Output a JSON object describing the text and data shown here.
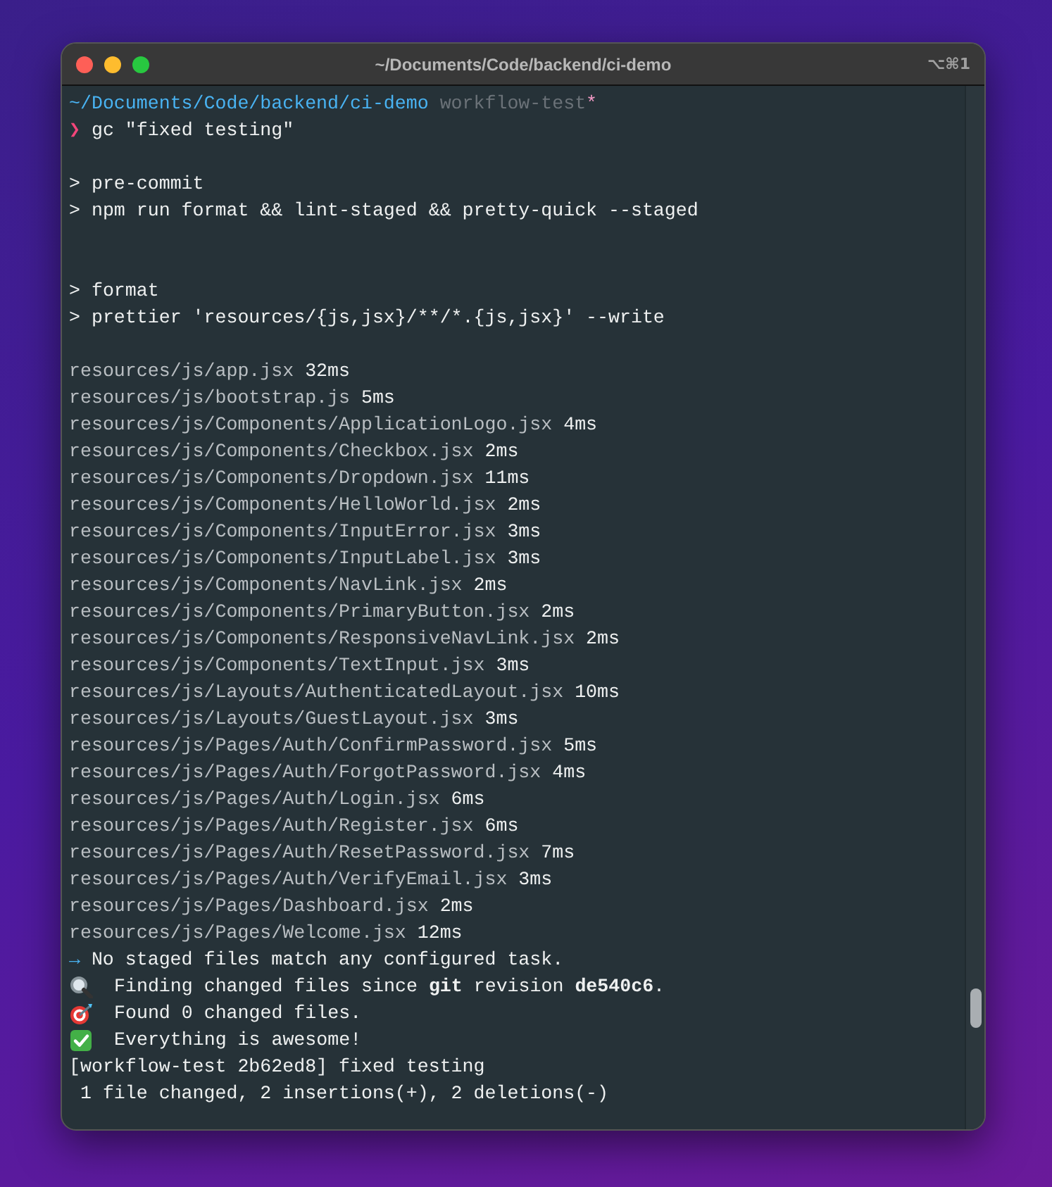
{
  "window": {
    "title": "~/Documents/Code/backend/ci-demo",
    "shortcut": "⌥⌘1"
  },
  "lines": [
    {
      "kind": "prompt",
      "path": "~/Documents/Code/backend/ci-demo",
      "branch": "workflow-test",
      "dirty": "*"
    },
    {
      "kind": "command",
      "marker": "❯",
      "text": "gc \"fixed testing\""
    },
    {
      "kind": "blank"
    },
    {
      "kind": "output",
      "text": "> pre-commit"
    },
    {
      "kind": "output",
      "text": "> npm run format && lint-staged && pretty-quick --staged"
    },
    {
      "kind": "blank"
    },
    {
      "kind": "blank"
    },
    {
      "kind": "output",
      "text": "> format"
    },
    {
      "kind": "output",
      "text": "> prettier 'resources/{js,jsx}/**/*.{js,jsx}' --write"
    },
    {
      "kind": "blank"
    },
    {
      "kind": "file",
      "path": "resources/js/app.jsx",
      "time": "32ms"
    },
    {
      "kind": "file",
      "path": "resources/js/bootstrap.js",
      "time": "5ms"
    },
    {
      "kind": "file",
      "path": "resources/js/Components/ApplicationLogo.jsx",
      "time": "4ms"
    },
    {
      "kind": "file",
      "path": "resources/js/Components/Checkbox.jsx",
      "time": "2ms"
    },
    {
      "kind": "file",
      "path": "resources/js/Components/Dropdown.jsx",
      "time": "11ms"
    },
    {
      "kind": "file",
      "path": "resources/js/Components/HelloWorld.jsx",
      "time": "2ms"
    },
    {
      "kind": "file",
      "path": "resources/js/Components/InputError.jsx",
      "time": "3ms"
    },
    {
      "kind": "file",
      "path": "resources/js/Components/InputLabel.jsx",
      "time": "3ms"
    },
    {
      "kind": "file",
      "path": "resources/js/Components/NavLink.jsx",
      "time": "2ms"
    },
    {
      "kind": "file",
      "path": "resources/js/Components/PrimaryButton.jsx",
      "time": "2ms"
    },
    {
      "kind": "file",
      "path": "resources/js/Components/ResponsiveNavLink.jsx",
      "time": "2ms"
    },
    {
      "kind": "file",
      "path": "resources/js/Components/TextInput.jsx",
      "time": "3ms"
    },
    {
      "kind": "file",
      "path": "resources/js/Layouts/AuthenticatedLayout.jsx",
      "time": "10ms"
    },
    {
      "kind": "file",
      "path": "resources/js/Layouts/GuestLayout.jsx",
      "time": "3ms"
    },
    {
      "kind": "file",
      "path": "resources/js/Pages/Auth/ConfirmPassword.jsx",
      "time": "5ms"
    },
    {
      "kind": "file",
      "path": "resources/js/Pages/Auth/ForgotPassword.jsx",
      "time": "4ms"
    },
    {
      "kind": "file",
      "path": "resources/js/Pages/Auth/Login.jsx",
      "time": "6ms"
    },
    {
      "kind": "file",
      "path": "resources/js/Pages/Auth/Register.jsx",
      "time": "6ms"
    },
    {
      "kind": "file",
      "path": "resources/js/Pages/Auth/ResetPassword.jsx",
      "time": "7ms"
    },
    {
      "kind": "file",
      "path": "resources/js/Pages/Auth/VerifyEmail.jsx",
      "time": "3ms"
    },
    {
      "kind": "file",
      "path": "resources/js/Pages/Dashboard.jsx",
      "time": "2ms"
    },
    {
      "kind": "file",
      "path": "resources/js/Pages/Welcome.jsx",
      "time": "12ms"
    },
    {
      "kind": "info",
      "marker": "→",
      "text": "No staged files match any configured task."
    },
    {
      "kind": "search",
      "text": "Finding changed files since **git** revision **de540c6**."
    },
    {
      "kind": "target",
      "text": "Found 0 changed files."
    },
    {
      "kind": "check",
      "text": "Everything is awesome!"
    },
    {
      "kind": "output",
      "text": "[workflow-test 2b62ed8] fixed testing"
    },
    {
      "kind": "output",
      "text": " 1 file changed, 2 insertions(+), 2 deletions(-)"
    }
  ]
}
